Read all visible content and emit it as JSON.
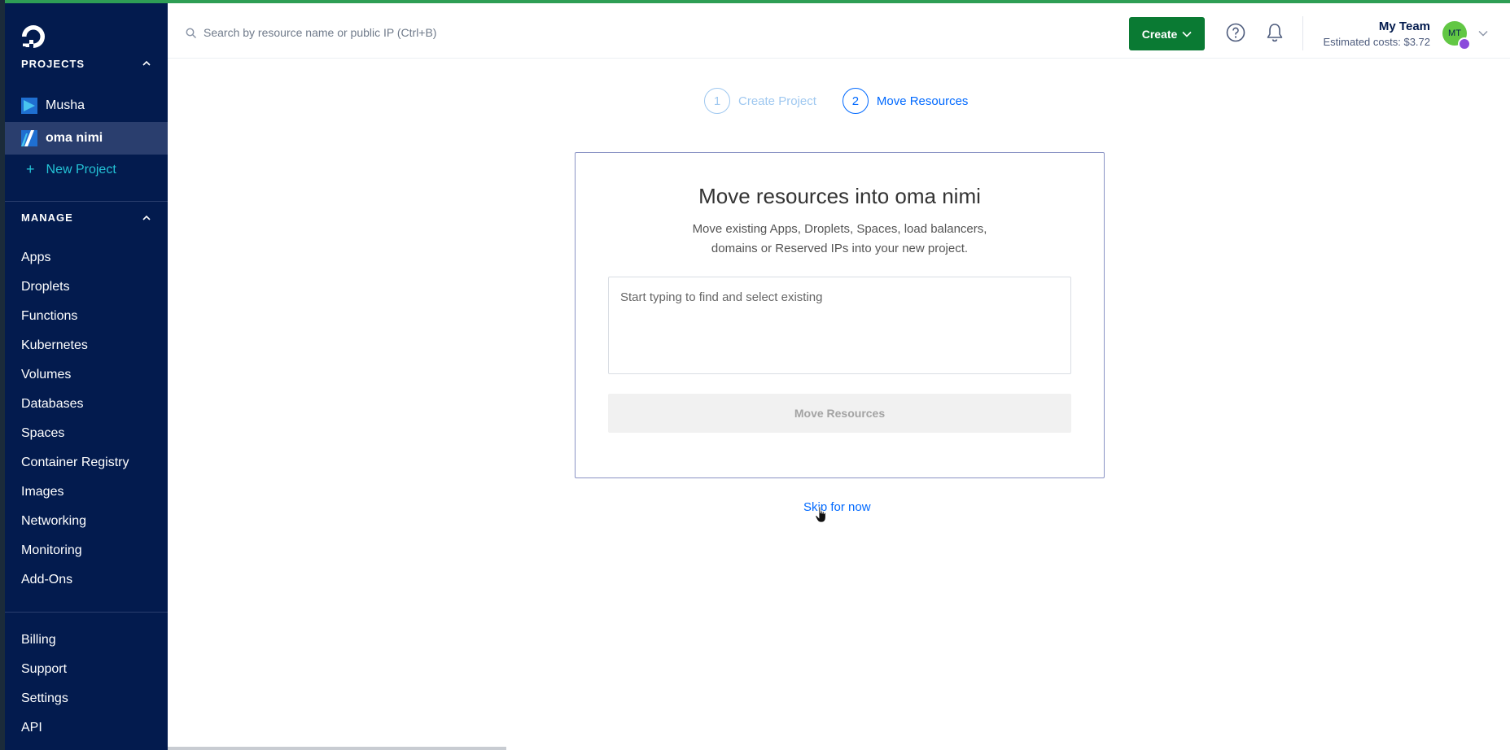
{
  "sidebar": {
    "logo_icon": "digitalocean-logo-icon",
    "projects_heading": "PROJECTS",
    "projects": [
      {
        "name": "Musha",
        "icon": "project-icon",
        "active": false
      },
      {
        "name": "oma nimi",
        "icon": "project-icon",
        "active": true
      }
    ],
    "new_project_label": "New Project",
    "manage_heading": "MANAGE",
    "manage_items": [
      "Apps",
      "Droplets",
      "Functions",
      "Kubernetes",
      "Volumes",
      "Databases",
      "Spaces",
      "Container Registry",
      "Images",
      "Networking",
      "Monitoring",
      "Add-Ons"
    ],
    "account_items": [
      "Billing",
      "Support",
      "Settings",
      "API"
    ]
  },
  "topbar": {
    "search_placeholder": "Search by resource name or public IP (Ctrl+B)",
    "create_label": "Create",
    "team_name": "My Team",
    "estimated_costs": "Estimated costs: $3.72",
    "avatar_initials": "MT"
  },
  "steps": [
    {
      "number": "1",
      "label": "Create Project",
      "state": "done"
    },
    {
      "number": "2",
      "label": "Move Resources",
      "state": "current"
    }
  ],
  "card": {
    "title": "Move resources into oma nimi",
    "description_line1": "Move existing Apps, Droplets, Spaces, load balancers,",
    "description_line2": "domains or Reserved IPs into your new project.",
    "resource_placeholder": "Start typing to find and select existing",
    "move_button_label": "Move Resources"
  },
  "skip_label": "Skip for now",
  "colors": {
    "sidebar_bg": "#031b4e",
    "accent_blue": "#0069ff",
    "create_green": "#0a7a33",
    "new_project_teal": "#24c3d6"
  }
}
